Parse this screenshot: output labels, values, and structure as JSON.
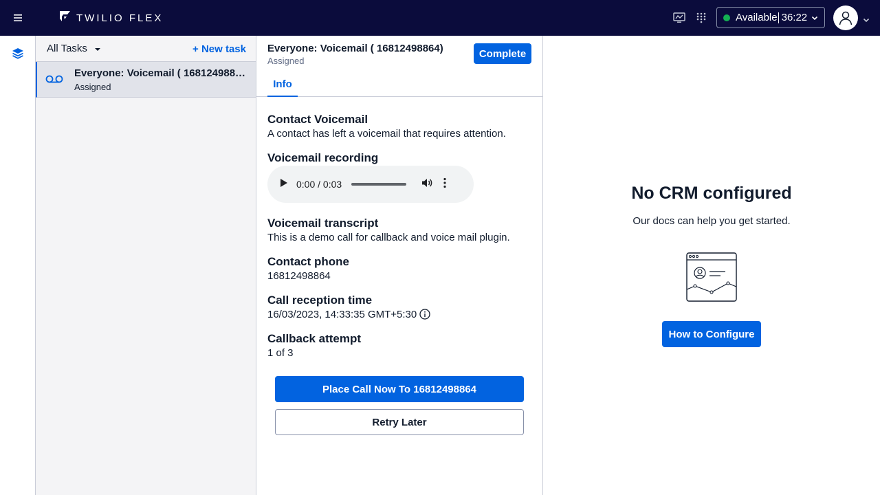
{
  "topbar": {
    "brand": "TWILIO FLEX",
    "status": {
      "label": "Available",
      "timer": "36:22",
      "color": "#14b053"
    },
    "icons": [
      "hamburger-icon",
      "twilio-logo-icon",
      "monitor-icon",
      "dialpad-icon",
      "user-avatar-icon",
      "chevron-down-icon"
    ]
  },
  "rail": {
    "icons": [
      "layers-icon"
    ]
  },
  "tasklist": {
    "filter": "All Tasks",
    "new_task": "+ New task",
    "items": [
      {
        "title": "Everyone: Voicemail ( 16812498864 )",
        "status": "Assigned",
        "icon": "voicemail-icon"
      }
    ]
  },
  "detail": {
    "title": "Everyone: Voicemail ( 16812498864)",
    "status": "Assigned",
    "complete": "Complete",
    "tabs": [
      "Info"
    ],
    "contact_voicemail": {
      "label": "Contact Voicemail",
      "value": "A contact has left a voicemail that requires attention."
    },
    "recording": {
      "label": "Voicemail recording",
      "time": "0:00 / 0:03"
    },
    "transcript": {
      "label": "Voicemail transcript",
      "value": "This is a demo call for callback and voice mail plugin."
    },
    "phone": {
      "label": "Contact phone",
      "value": "16812498864"
    },
    "reception": {
      "label": "Call reception time",
      "value": "16/03/2023, 14:33:35 GMT+5:30"
    },
    "attempt": {
      "label": "Callback attempt",
      "value": "1 of 3"
    },
    "place_call": "Place Call Now To 16812498864",
    "retry_later": "Retry Later"
  },
  "crm": {
    "title": "No CRM configured",
    "subtitle": "Our docs can help you get started.",
    "button": "How to Configure"
  },
  "colors": {
    "topbar_bg": "#0b0c3c",
    "accent": "#0263e0",
    "available": "#14b053"
  }
}
